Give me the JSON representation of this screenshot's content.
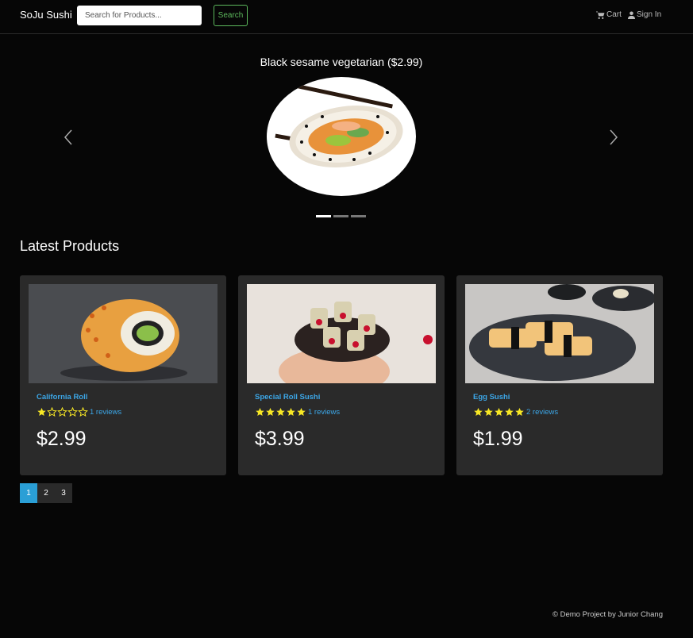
{
  "navbar": {
    "brand": "SoJu Sushi",
    "search_placeholder": "Search for Products...",
    "search_button": "Search",
    "cart_label": "Cart",
    "signin_label": "Sign In"
  },
  "carousel": {
    "caption": "Black sesame vegetarian ($2.99)",
    "slides": 3,
    "active_slide": 1
  },
  "latest": {
    "title": "Latest Products",
    "products": [
      {
        "name": "California Roll",
        "rating": 1,
        "reviews": "1 reviews",
        "price": "$2.99"
      },
      {
        "name": "Special Roll Sushi",
        "rating": 5,
        "reviews": "1 reviews",
        "price": "$3.99"
      },
      {
        "name": "Egg Sushi",
        "rating": 5,
        "reviews": "2 reviews",
        "price": "$1.99"
      }
    ]
  },
  "pagination": {
    "pages": [
      "1",
      "2",
      "3"
    ],
    "active": "1"
  },
  "footer": {
    "text": "© Demo Project by Junior Chang"
  },
  "colors": {
    "accent": "#2a9fd6",
    "link": "#3ca7e8",
    "star": "#f8e825",
    "success": "#5cb85c",
    "card": "#2a2a2a"
  }
}
